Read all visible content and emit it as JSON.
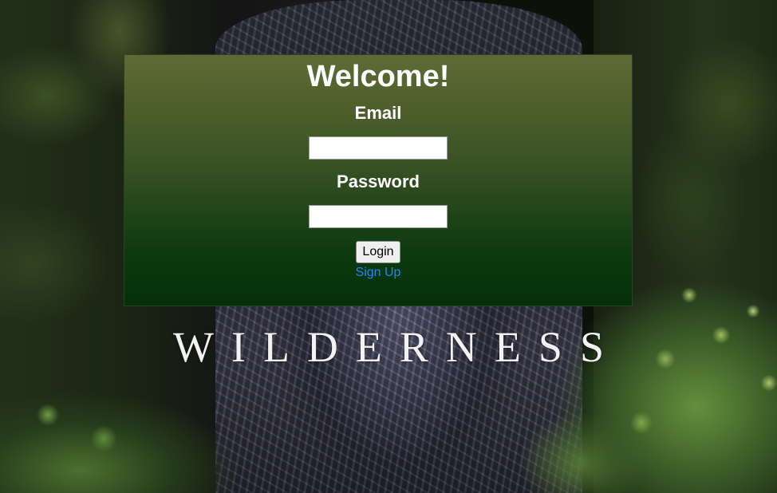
{
  "login": {
    "title": "Welcome!",
    "email_label": "Email",
    "email_value": "",
    "password_label": "Password",
    "password_value": "",
    "login_button": "Login",
    "signup_link": "Sign Up"
  },
  "background": {
    "watermark_text": "WILDERNESS"
  },
  "colors": {
    "panel_gradient_top": "#5f6b34",
    "panel_gradient_bottom": "#043108",
    "link_color": "#1f86ff",
    "text_color": "#ffffff"
  }
}
